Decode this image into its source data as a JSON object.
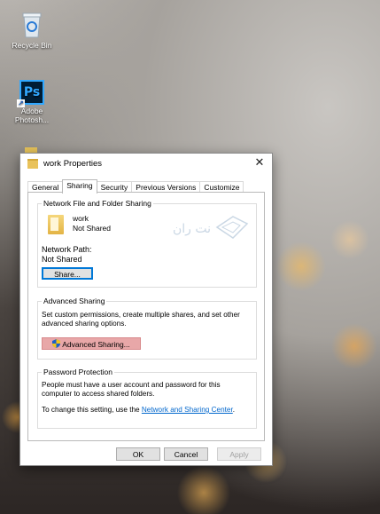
{
  "desktop": {
    "icons": [
      {
        "label": "Recycle Bin",
        "icon": "recycle-bin-icon"
      },
      {
        "label": "Adobe Photosh...",
        "icon": "photoshop-icon",
        "glyph": "Ps"
      }
    ]
  },
  "dialog": {
    "title": "work Properties",
    "close_glyph": "✕",
    "tabs": [
      "General",
      "Sharing",
      "Security",
      "Previous Versions",
      "Customize"
    ],
    "active_tab": "Sharing",
    "network_sharing": {
      "title": "Network File and Folder Sharing",
      "folder_name": "work",
      "folder_status": "Not Shared",
      "network_path_label": "Network Path:",
      "network_path_value": "Not Shared",
      "share_button": "Share..."
    },
    "advanced_sharing": {
      "title": "Advanced Sharing",
      "description": "Set custom permissions, create multiple shares, and set other advanced sharing options.",
      "button": "Advanced Sharing..."
    },
    "password_protection": {
      "title": "Password Protection",
      "description": "People must have a user account and password for this computer to access shared folders.",
      "change_prefix": "To change this setting, use the ",
      "change_link": "Network and Sharing Center",
      "change_suffix": "."
    },
    "buttons": {
      "ok": "OK",
      "cancel": "Cancel",
      "apply": "Apply"
    }
  },
  "watermark": {
    "text": "نت ران"
  },
  "colors": {
    "link": "#0066cc",
    "focus": "#0078d7",
    "highlight": "#e8a7a8"
  }
}
